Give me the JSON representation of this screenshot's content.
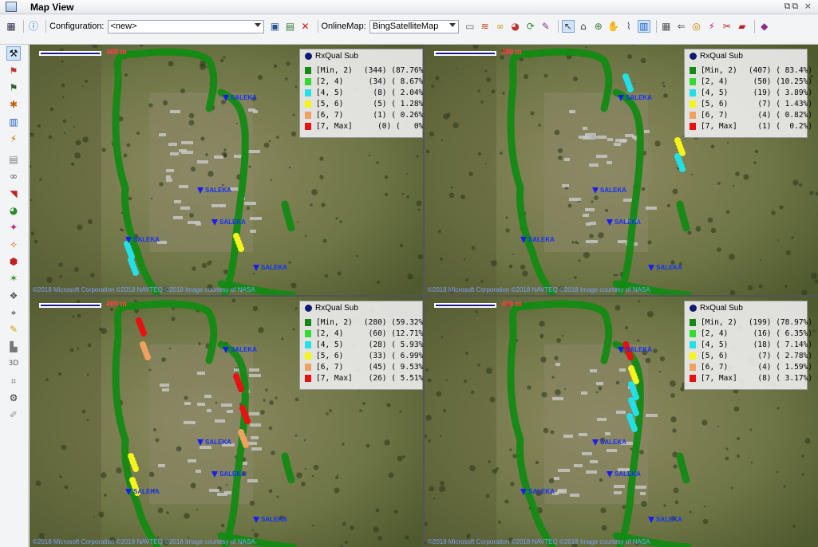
{
  "window": {
    "title": "Map View",
    "controls": "⧉⧉ ×"
  },
  "toolbar": {
    "config_label": "Configuration:",
    "config_value": "<new>",
    "onlinemap_label": "OnlineMap:",
    "onlinemap_value": "BingSatelliteMap"
  },
  "panes": [
    {
      "scale": "400 m",
      "copyright": "©2018 Microsoft Corporation ©2018 NAVTEQ ©2018 Image courtesy of NASA",
      "legend": {
        "title": "RxQual Sub",
        "rows": [
          {
            "range": "[Min, 2)",
            "count": "(344) (87.76%)",
            "color": "#138a13"
          },
          {
            "range": "[2, 4)",
            "count": "(34) ( 8.67%)",
            "color": "#2fdc2f"
          },
          {
            "range": "[4, 5)",
            "count": "(8) ( 2.04%)",
            "color": "#22e0e8"
          },
          {
            "range": "[5, 6)",
            "count": "(5) ( 1.28%)",
            "color": "#f5f51a"
          },
          {
            "range": "[6, 7)",
            "count": "(1) ( 0.26%)",
            "color": "#f0a060"
          },
          {
            "range": "[7, Max]",
            "count": "(0) (   0%)",
            "color": "#e81010"
          }
        ]
      },
      "sites": [
        "SALEKA",
        "SALEKA",
        "SALEKA",
        "SALEKA",
        "SALEKA"
      ]
    },
    {
      "scale": "400 m",
      "copyright": "©2018 Microsoft Corporation ©2018 NAVTEQ ©2018 Image courtesy of NASA",
      "legend": {
        "title": "RxQual Sub",
        "rows": [
          {
            "range": "[Min, 2)",
            "count": "(407) ( 83.4%)",
            "color": "#138a13"
          },
          {
            "range": "[2, 4)",
            "count": "(50) (10.25%)",
            "color": "#2fdc2f"
          },
          {
            "range": "[4, 5)",
            "count": "(19) ( 3.89%)",
            "color": "#22e0e8"
          },
          {
            "range": "[5, 6)",
            "count": "(7) ( 1.43%)",
            "color": "#f5f51a"
          },
          {
            "range": "[6, 7)",
            "count": "(4) ( 0.82%)",
            "color": "#f0a060"
          },
          {
            "range": "[7, Max]",
            "count": "(1) (  0.2%)",
            "color": "#e81010"
          }
        ]
      },
      "sites": [
        "SALEKA",
        "SALEKA",
        "SALEKA",
        "SALEKA",
        "SALEKA"
      ]
    },
    {
      "scale": "400 m",
      "copyright": "©2018 Microsoft Corporation ©2018 NAVTEQ ©2018 Image courtesy of NASA",
      "legend": {
        "title": "RxQual Sub",
        "rows": [
          {
            "range": "[Min, 2)",
            "count": "(280) (59.32%)",
            "color": "#138a13"
          },
          {
            "range": "[2, 4)",
            "count": "(60) (12.71%)",
            "color": "#2fdc2f"
          },
          {
            "range": "[4, 5)",
            "count": "(28) ( 5.93%)",
            "color": "#22e0e8"
          },
          {
            "range": "[5, 6)",
            "count": "(33) ( 6.99%)",
            "color": "#f5f51a"
          },
          {
            "range": "[6, 7)",
            "count": "(45) ( 9.53%)",
            "color": "#f0a060"
          },
          {
            "range": "[7, Max]",
            "count": "(26) ( 5.51%)",
            "color": "#e81010"
          }
        ]
      },
      "sites": [
        "SALEKA",
        "SALEKA",
        "SALEKA",
        "SALEKA",
        "SALEKA"
      ]
    },
    {
      "scale": "400 m",
      "copyright": "©2018 Microsoft Corporation ©2018 NAVTEQ ©2018 Image courtesy of NASA",
      "legend": {
        "title": "RxQual Sub",
        "rows": [
          {
            "range": "[Min, 2)",
            "count": "(199) (78.97%)",
            "color": "#138a13"
          },
          {
            "range": "[2, 4)",
            "count": "(16) ( 6.35%)",
            "color": "#2fdc2f"
          },
          {
            "range": "[4, 5)",
            "count": "(18) ( 7.14%)",
            "color": "#22e0e8"
          },
          {
            "range": "[5, 6)",
            "count": "(7) ( 2.78%)",
            "color": "#f5f51a"
          },
          {
            "range": "[6, 7)",
            "count": "(4) ( 1.59%)",
            "color": "#f0a060"
          },
          {
            "range": "[7, Max]",
            "count": "(8) ( 3.17%)",
            "color": "#e81010"
          }
        ]
      },
      "sites": [
        "SALEKA",
        "SALEKA",
        "SALEKA",
        "SALEKA",
        "SALEKA"
      ]
    }
  ],
  "icons": {
    "toolbar": [
      "layout-icon",
      "info-icon",
      "save-icon",
      "export-icon",
      "delete-icon",
      "map-layers-icon",
      "refresh-icon",
      "measure-icon",
      "select-arrow-icon",
      "home-icon",
      "pan-icon",
      "chart-icon",
      "zoom-icon",
      "settings-icon",
      "book-icon"
    ],
    "left": [
      "select-icon",
      "route-icon",
      "route-sub-icon",
      "point-icon",
      "table-icon",
      "signal-icon",
      "ruler-icon",
      "link-icon",
      "site-icon",
      "pie-icon",
      "flag-icon",
      "polygon-icon",
      "location-icon",
      "crosshair-icon",
      "pencil-icon",
      "chart-area-icon",
      "3d-icon",
      "frame-icon",
      "tool-icon",
      "pin-icon"
    ]
  }
}
